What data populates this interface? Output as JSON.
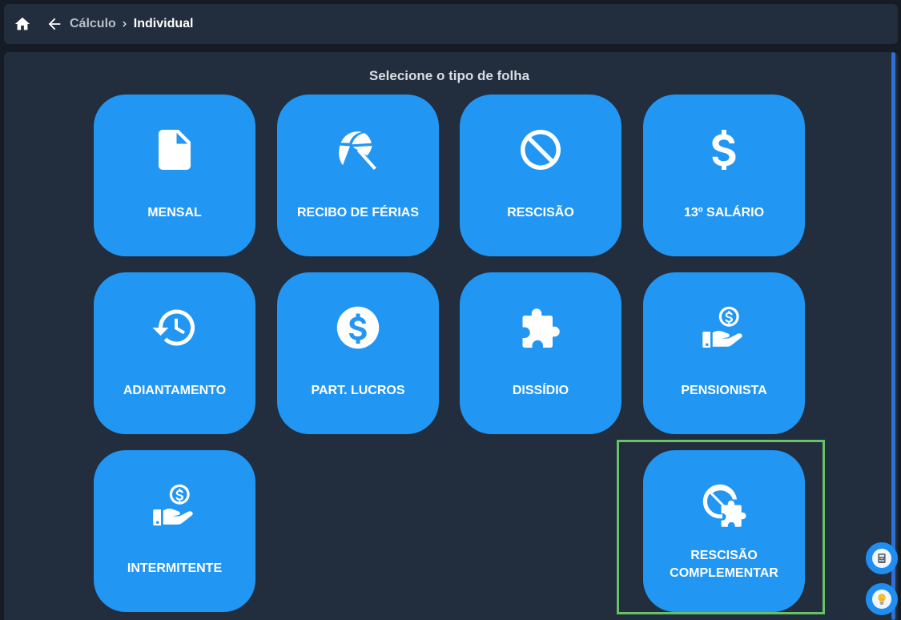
{
  "header": {
    "breadcrumb_parent": "Cálculo",
    "breadcrumb_current": "Individual",
    "icons": [
      "home-icon",
      "arrow-left-icon",
      "chevron-right-icon"
    ]
  },
  "main": {
    "title": "Selecione o tipo de folha",
    "tiles": [
      {
        "label": "MENSAL",
        "icon": "document-icon"
      },
      {
        "label": "RECIBO DE FÉRIAS",
        "icon": "beach-umbrella-icon"
      },
      {
        "label": "RESCISÃO",
        "icon": "prohibited-icon"
      },
      {
        "label": "13º SALÁRIO",
        "icon": "dollar-sign-icon"
      },
      {
        "label": "ADIANTAMENTO",
        "icon": "history-icon"
      },
      {
        "label": "PART. LUCROS",
        "icon": "dollar-circle-icon"
      },
      {
        "label": "DISSÍDIO",
        "icon": "puzzle-icon"
      },
      {
        "label": "PENSIONISTA",
        "icon": "hand-coin-icon"
      },
      {
        "label": "INTERMITENTE",
        "icon": "hand-coin-icon"
      },
      {
        "label_line1": "RESCISÃO",
        "label_line2": "COMPLEMENTAR",
        "icon": "prohibited-puzzle-icon"
      }
    ]
  },
  "colors": {
    "background": "#151c26",
    "panel": "#222d3d",
    "tile": "#2196f3",
    "highlight": "#66c264",
    "scrollbar": "#2d6fd2"
  }
}
